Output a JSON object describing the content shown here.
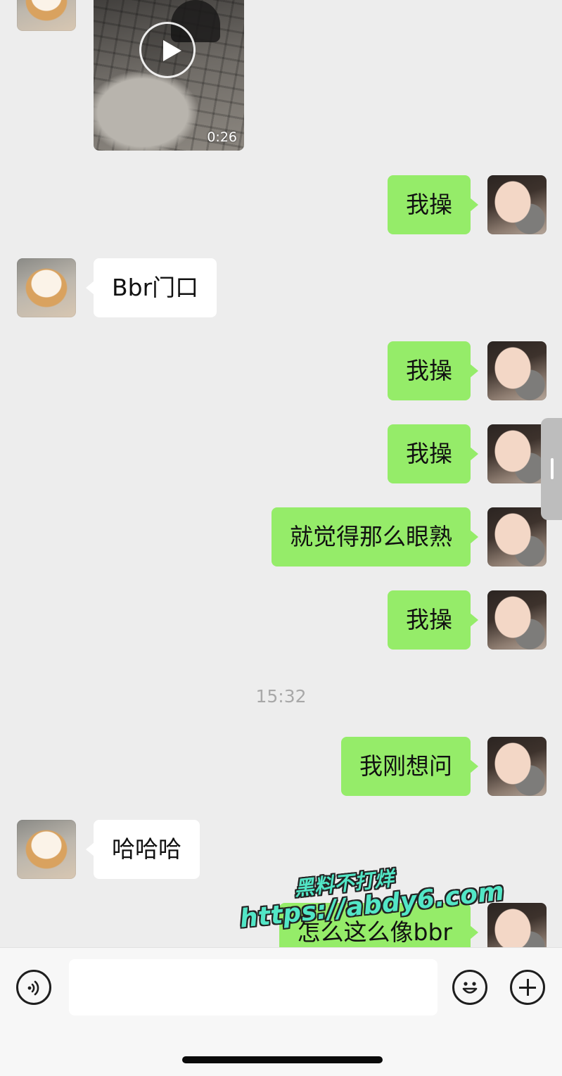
{
  "chat": {
    "video": {
      "duration": "0:26"
    },
    "messages": [
      {
        "side": "out",
        "text": "我操"
      },
      {
        "side": "in",
        "text": "Bbr门口"
      },
      {
        "side": "out",
        "text": "我操"
      },
      {
        "side": "out",
        "text": "我操"
      },
      {
        "side": "out",
        "text": "就觉得那么眼熟"
      },
      {
        "side": "out",
        "text": "我操"
      },
      {
        "side": "out",
        "text": "我刚想问"
      },
      {
        "side": "in",
        "text": "哈哈哈"
      },
      {
        "side": "out",
        "text": "怎么这么像bbr"
      }
    ],
    "timestamp": "15:32"
  },
  "watermark": {
    "line1": "黑料不打烊",
    "line2": "https://abdy6.com"
  },
  "input_bar": {
    "voice_icon": "voice-icon",
    "emoji_icon": "emoji-icon",
    "plus_icon": "plus-icon",
    "input_value": ""
  },
  "colors": {
    "background": "#ededed",
    "outgoing_bubble": "#95ec69",
    "incoming_bubble": "#ffffff",
    "watermark": "#52e6c6"
  }
}
